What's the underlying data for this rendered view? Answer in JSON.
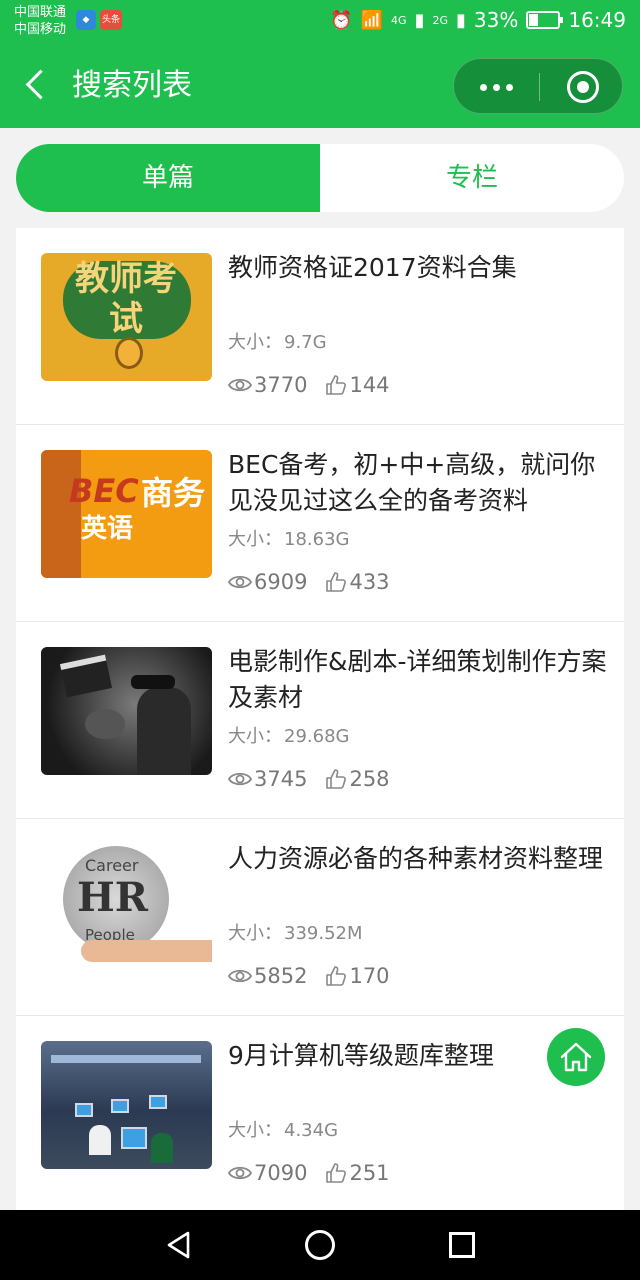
{
  "status_bar": {
    "carrier_1": "中国联通",
    "carrier_2": "中国移动",
    "app_badge": "头条",
    "signal_1": "4G",
    "signal_2": "2G",
    "battery": "33%",
    "battery_level": 0.33,
    "time": "16:49"
  },
  "header": {
    "title": "搜索列表"
  },
  "tabs": [
    {
      "label": "单篇",
      "active": true
    },
    {
      "label": "专栏",
      "active": false
    }
  ],
  "items": [
    {
      "title": "教师资格证2017资料合集",
      "size_label": "大小：",
      "size": "9.7G",
      "views": "3770",
      "likes": "144",
      "thumb_text": "教师考试"
    },
    {
      "title": "BEC备考，初+中+高级，就问你见没见过这么全的备考资料",
      "size_label": "大小：",
      "size": "18.63G",
      "views": "6909",
      "likes": "433",
      "thumb_text_1": "BEC",
      "thumb_text_2": "商务",
      "thumb_text_3": "英语"
    },
    {
      "title": "电影制作&剧本-详细策划制作方案及素材",
      "size_label": "大小：",
      "size": "29.68G",
      "views": "3745",
      "likes": "258"
    },
    {
      "title": "人力资源必备的各种素材资料整理",
      "size_label": "大小：",
      "size": "339.52M",
      "views": "5852",
      "likes": "170",
      "thumb_text_1": "HR",
      "thumb_text_2": "Career",
      "thumb_text_3": "People"
    },
    {
      "title": "9月计算机等级题库整理",
      "size_label": "大小：",
      "size": "4.34G",
      "views": "7090",
      "likes": "251"
    }
  ],
  "colors": {
    "accent": "#1fbf4f",
    "capsule": "#168f3a"
  },
  "icons": [
    "back-arrow-icon",
    "more-dots-icon",
    "target-icon",
    "eye-icon",
    "thumb-up-icon",
    "home-icon"
  ]
}
